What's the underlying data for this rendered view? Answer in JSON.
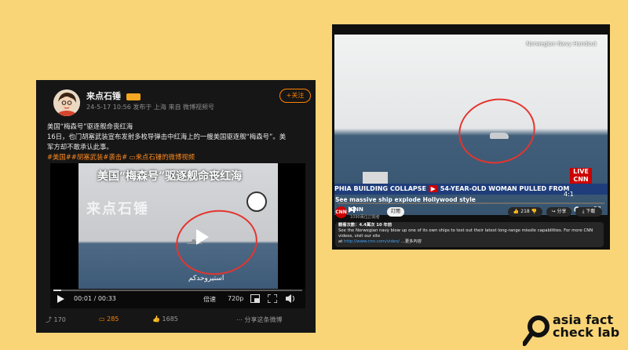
{
  "weibo": {
    "user_name": "来点石锤",
    "level_badge": "6",
    "meta": "24-5-17 10:56 发布于 上海 来自 微博视频号",
    "follow_label": "+关注",
    "post_line1": "美国“梅森号”驱逐舰命丧红海",
    "post_line2": "16日，也门胡塞武装宣布发射多枚导弹击中红海上的一艘美国驱逐舰“梅森号”。美",
    "post_line3": "军方却不敢承认此事。",
    "post_tags": "#美国##胡塞武装#袭击# ▭来点石锤的微博视频",
    "video": {
      "caption": "美国“梅森号”驱逐舰命丧红海",
      "watermark": "来点石锤",
      "arabic_text": "استيروحدكم",
      "time_current": "00:01",
      "time_total": "00:33",
      "time_display": "00:01 / 00:33",
      "speed_label": "倍速",
      "quality_label": "720p",
      "progress": 0.03
    },
    "actions": {
      "reposts": "170",
      "comments": "285",
      "likes": "1685",
      "share_label": "分享这条微博"
    }
  },
  "youtube": {
    "watermark": "Norwegian Navy Handout",
    "ticker_left": "PHIA BUILDING COLLAPSE",
    "ticker_right": "54-YEAR-OLD WOMAN PULLED FROM",
    "live_label": "LIVE CNN",
    "time_display": "4:1",
    "title": "See massive ship explode Hollywood style",
    "channel": "CNN",
    "subscribers": "1090萬位訂閱者",
    "subscribe_label": "訂閱",
    "likes": "218",
    "share_label": "分享",
    "download_label": "下載",
    "desc_stats": "觀看次數：4.4萬次 10 年前",
    "desc_line1": "See the Norwegian navy blow up one of its own ships to test out their latest long-range missile capabilities. For more CNN videos, visit our site",
    "desc_line2_prefix": "at ",
    "desc_link": "http://www.cnn.com/video/",
    "desc_more": " ...更多內容"
  },
  "logo": {
    "line1": "asia fact",
    "line2": "check lab"
  },
  "colors": {
    "background": "#f9d577",
    "weibo_orange": "#ff8200",
    "highlight_circle": "#e4352f",
    "youtube_bg": "#0f0f0f"
  }
}
